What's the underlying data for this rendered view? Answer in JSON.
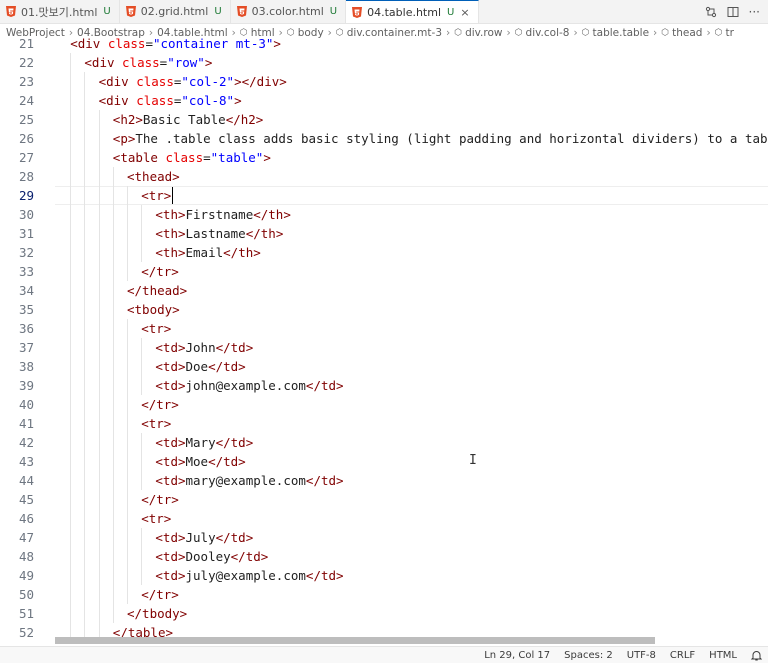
{
  "tabs": [
    {
      "label": "01.맛보기.html",
      "status": "U",
      "active": false
    },
    {
      "label": "02.grid.html",
      "status": "U",
      "active": false
    },
    {
      "label": "03.color.html",
      "status": "U",
      "active": false
    },
    {
      "label": "04.table.html",
      "status": "U",
      "active": true,
      "close": "×"
    }
  ],
  "breadcrumb": [
    "WebProject",
    "04.Bootstrap",
    "04.table.html",
    "html",
    "body",
    "div.container.mt-3",
    "div.row",
    "div.col-8",
    "table.table",
    "thead",
    "tr"
  ],
  "editor": {
    "current_line": 29,
    "lines": [
      {
        "n": 21,
        "indent": 1,
        "parts": [
          [
            "t",
            "<div "
          ],
          [
            "a",
            "class"
          ],
          [
            "p",
            "="
          ],
          [
            "v",
            "\"container mt-3\""
          ],
          [
            "t",
            ">"
          ]
        ]
      },
      {
        "n": 22,
        "indent": 2,
        "parts": [
          [
            "t",
            "<div "
          ],
          [
            "a",
            "class"
          ],
          [
            "p",
            "="
          ],
          [
            "v",
            "\"row\""
          ],
          [
            "t",
            ">"
          ]
        ]
      },
      {
        "n": 23,
        "indent": 3,
        "parts": [
          [
            "t",
            "<div "
          ],
          [
            "a",
            "class"
          ],
          [
            "p",
            "="
          ],
          [
            "v",
            "\"col-2\""
          ],
          [
            "t",
            "></div>"
          ]
        ]
      },
      {
        "n": 24,
        "indent": 3,
        "parts": [
          [
            "t",
            "<div "
          ],
          [
            "a",
            "class"
          ],
          [
            "p",
            "="
          ],
          [
            "v",
            "\"col-8\""
          ],
          [
            "t",
            ">"
          ]
        ]
      },
      {
        "n": 25,
        "indent": 4,
        "parts": [
          [
            "t",
            "<h2>"
          ],
          [
            "p",
            "Basic Table"
          ],
          [
            "t",
            "</h2>"
          ]
        ]
      },
      {
        "n": 26,
        "indent": 4,
        "parts": [
          [
            "t",
            "<p>"
          ],
          [
            "p",
            "The .table class adds basic styling (light padding and horizontal dividers) to a table:"
          ],
          [
            "t",
            "<"
          ]
        ]
      },
      {
        "n": 27,
        "indent": 4,
        "parts": [
          [
            "t",
            "<table "
          ],
          [
            "a",
            "class"
          ],
          [
            "p",
            "="
          ],
          [
            "v",
            "\"table\""
          ],
          [
            "t",
            ">"
          ]
        ]
      },
      {
        "n": 28,
        "indent": 5,
        "parts": [
          [
            "t",
            "<thead>"
          ]
        ]
      },
      {
        "n": 29,
        "indent": 6,
        "parts": [
          [
            "t",
            "<tr>"
          ]
        ]
      },
      {
        "n": 30,
        "indent": 7,
        "parts": [
          [
            "t",
            "<th>"
          ],
          [
            "p",
            "Firstname"
          ],
          [
            "t",
            "</th>"
          ]
        ]
      },
      {
        "n": 31,
        "indent": 7,
        "parts": [
          [
            "t",
            "<th>"
          ],
          [
            "p",
            "Lastname"
          ],
          [
            "t",
            "</th>"
          ]
        ]
      },
      {
        "n": 32,
        "indent": 7,
        "parts": [
          [
            "t",
            "<th>"
          ],
          [
            "p",
            "Email"
          ],
          [
            "t",
            "</th>"
          ]
        ]
      },
      {
        "n": 33,
        "indent": 6,
        "parts": [
          [
            "t",
            "</tr>"
          ]
        ]
      },
      {
        "n": 34,
        "indent": 5,
        "parts": [
          [
            "t",
            "</thead>"
          ]
        ]
      },
      {
        "n": 35,
        "indent": 5,
        "parts": [
          [
            "t",
            "<tbody>"
          ]
        ]
      },
      {
        "n": 36,
        "indent": 6,
        "parts": [
          [
            "t",
            "<tr>"
          ]
        ]
      },
      {
        "n": 37,
        "indent": 7,
        "parts": [
          [
            "t",
            "<td>"
          ],
          [
            "p",
            "John"
          ],
          [
            "t",
            "</td>"
          ]
        ]
      },
      {
        "n": 38,
        "indent": 7,
        "parts": [
          [
            "t",
            "<td>"
          ],
          [
            "p",
            "Doe"
          ],
          [
            "t",
            "</td>"
          ]
        ]
      },
      {
        "n": 39,
        "indent": 7,
        "parts": [
          [
            "t",
            "<td>"
          ],
          [
            "p",
            "john@example.com"
          ],
          [
            "t",
            "</td>"
          ]
        ]
      },
      {
        "n": 40,
        "indent": 6,
        "parts": [
          [
            "t",
            "</tr>"
          ]
        ]
      },
      {
        "n": 41,
        "indent": 6,
        "parts": [
          [
            "t",
            "<tr>"
          ]
        ]
      },
      {
        "n": 42,
        "indent": 7,
        "parts": [
          [
            "t",
            "<td>"
          ],
          [
            "p",
            "Mary"
          ],
          [
            "t",
            "</td>"
          ]
        ]
      },
      {
        "n": 43,
        "indent": 7,
        "parts": [
          [
            "t",
            "<td>"
          ],
          [
            "p",
            "Moe"
          ],
          [
            "t",
            "</td>"
          ]
        ]
      },
      {
        "n": 44,
        "indent": 7,
        "parts": [
          [
            "t",
            "<td>"
          ],
          [
            "p",
            "mary@example.com"
          ],
          [
            "t",
            "</td>"
          ]
        ]
      },
      {
        "n": 45,
        "indent": 6,
        "parts": [
          [
            "t",
            "</tr>"
          ]
        ]
      },
      {
        "n": 46,
        "indent": 6,
        "parts": [
          [
            "t",
            "<tr>"
          ]
        ]
      },
      {
        "n": 47,
        "indent": 7,
        "parts": [
          [
            "t",
            "<td>"
          ],
          [
            "p",
            "July"
          ],
          [
            "t",
            "</td>"
          ]
        ]
      },
      {
        "n": 48,
        "indent": 7,
        "parts": [
          [
            "t",
            "<td>"
          ],
          [
            "p",
            "Dooley"
          ],
          [
            "t",
            "</td>"
          ]
        ]
      },
      {
        "n": 49,
        "indent": 7,
        "parts": [
          [
            "t",
            "<td>"
          ],
          [
            "p",
            "july@example.com"
          ],
          [
            "t",
            "</td>"
          ]
        ]
      },
      {
        "n": 50,
        "indent": 6,
        "parts": [
          [
            "t",
            "</tr>"
          ]
        ]
      },
      {
        "n": 51,
        "indent": 5,
        "parts": [
          [
            "t",
            "</tbody>"
          ]
        ]
      },
      {
        "n": 52,
        "indent": 4,
        "parts": [
          [
            "t",
            "</table>"
          ]
        ]
      }
    ]
  },
  "statusbar": {
    "position": "Ln 29, Col 17",
    "spaces": "Spaces: 2",
    "encoding": "UTF-8",
    "eol": "CRLF",
    "language": "HTML"
  },
  "colors": {
    "tag": "#800000",
    "attribute": "#e50000",
    "value": "#0000ff",
    "html_icon": "#e44d26",
    "untracked": "#1e7a36"
  }
}
